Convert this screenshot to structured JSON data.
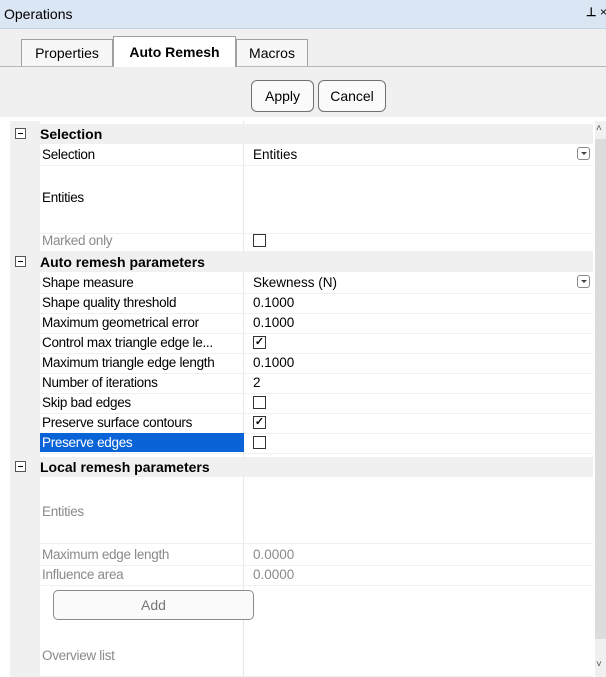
{
  "window": {
    "title": "Operations",
    "pin_glyph": "⊥",
    "close_glyph": "×"
  },
  "tabs": [
    {
      "label": "Properties",
      "active": false
    },
    {
      "label": "Auto Remesh",
      "active": true
    },
    {
      "label": "Macros",
      "active": false
    }
  ],
  "buttons": {
    "apply": "Apply",
    "cancel": "Cancel",
    "add": "Add"
  },
  "sections": {
    "selection": {
      "title": "Selection",
      "rows": [
        {
          "name": "Selection",
          "value": "Entities"
        },
        {
          "name": "Entities",
          "value": ""
        },
        {
          "name": "Marked only",
          "value": ""
        }
      ]
    },
    "auto": {
      "title": "Auto remesh parameters",
      "rows": [
        {
          "name": "Shape measure",
          "value": "Skewness (N)"
        },
        {
          "name": "Shape quality threshold",
          "value": "0.1000"
        },
        {
          "name": "Maximum geometrical error",
          "value": "0.1000"
        },
        {
          "name": "Control max triangle edge le...",
          "value": "checked"
        },
        {
          "name": "Maximum triangle edge length",
          "value": "0.1000"
        },
        {
          "name": "Number of iterations",
          "value": "2"
        },
        {
          "name": "Skip bad edges",
          "value": "unchecked"
        },
        {
          "name": "Preserve surface contours",
          "value": "checked"
        },
        {
          "name": "Preserve edges",
          "value": "unchecked"
        }
      ]
    },
    "local": {
      "title": "Local remesh parameters",
      "rows": [
        {
          "name": "Entities",
          "value": ""
        },
        {
          "name": "Maximum edge length",
          "value": "0.0000"
        },
        {
          "name": "Influence area",
          "value": "0.0000"
        },
        {
          "name": "Overview list",
          "value": ""
        }
      ]
    }
  },
  "check_glyph": "✓",
  "colors": {
    "selection_highlight": "#0a64d8",
    "title_bar": "#dae6f3"
  }
}
